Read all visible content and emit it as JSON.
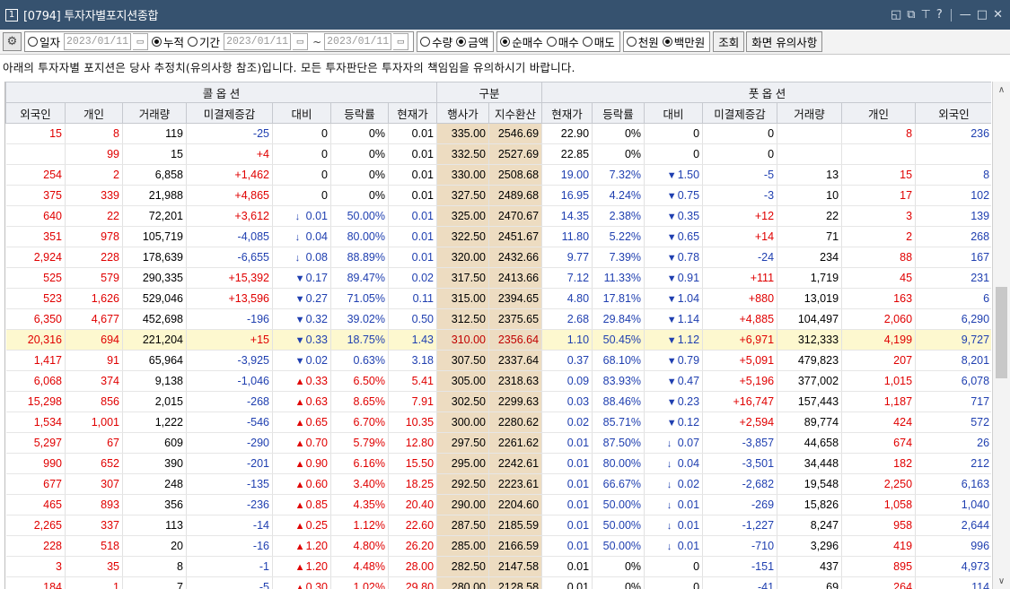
{
  "window": {
    "number": "1",
    "title": "[0794] 투자자별포지션종합",
    "controls": [
      "◱",
      "⧉",
      "⊤",
      "?",
      "—",
      "□",
      "✕"
    ]
  },
  "toolbar": {
    "gear_icon": "⚙",
    "radio_daily": "일자",
    "date_single": "2023/01/11",
    "radio_cumulative": "누적",
    "radio_period": "기간",
    "date_from": "2023/01/11",
    "tilde": "~",
    "date_to": "2023/01/11",
    "radio_quantity": "수량",
    "radio_amount": "금액",
    "radio_net_buy": "순매수",
    "radio_buy": "매수",
    "radio_sell": "매도",
    "radio_thousand": "천원",
    "radio_million": "백만원",
    "query_button": "조회",
    "notice_button": "화면 유의사항",
    "calendar_icon": "▭"
  },
  "notice": "아래의 투자자별 포지션은 당사 추정치(유의사항 참조)입니다. 모든 투자판단은 투자자의 책임임을 유의하시기 바랍니다.",
  "grid": {
    "group_call": "콜 옵 션",
    "group_mid": "구분",
    "group_put": "풋 옵 션",
    "columns": [
      "외국인",
      "개인",
      "거래량",
      "미결제증감",
      "대비",
      "등락률",
      "현재가",
      "행사가",
      "지수환산",
      "현재가",
      "등락률",
      "대비",
      "미결제증감",
      "거래량",
      "개인",
      "외국인"
    ],
    "rows": [
      [
        "15",
        "8",
        "119",
        "-25",
        "",
        "0",
        "0%",
        "0.01",
        "335.00",
        "2546.69",
        "22.90",
        "0%",
        "",
        "0",
        "0",
        "",
        "8",
        "236"
      ],
      [
        "",
        "99",
        "15",
        "+4",
        "",
        "0",
        "0%",
        "0.01",
        "332.50",
        "2527.69",
        "22.85",
        "0%",
        "",
        "0",
        "0",
        "",
        "",
        ""
      ],
      [
        "254",
        "2",
        "6,858",
        "+1,462",
        "",
        "0",
        "0%",
        "0.01",
        "330.00",
        "2508.68",
        "19.00",
        "7.32%",
        "▼",
        "1.50",
        "-5",
        "13",
        "15",
        "8"
      ],
      [
        "375",
        "339",
        "21,988",
        "+4,865",
        "",
        "0",
        "0%",
        "0.01",
        "327.50",
        "2489.68",
        "16.95",
        "4.24%",
        "▼",
        "0.75",
        "-3",
        "10",
        "17",
        "102"
      ],
      [
        "640",
        "22",
        "72,201",
        "+3,612",
        "↓",
        "0.01",
        "50.00%",
        "0.01",
        "325.00",
        "2470.67",
        "14.35",
        "2.38%",
        "▼",
        "0.35",
        "+12",
        "22",
        "3",
        "139"
      ],
      [
        "351",
        "978",
        "105,719",
        "-4,085",
        "↓",
        "0.04",
        "80.00%",
        "0.01",
        "322.50",
        "2451.67",
        "11.80",
        "5.22%",
        "▼",
        "0.65",
        "+14",
        "71",
        "2",
        "268"
      ],
      [
        "2,924",
        "228",
        "178,639",
        "-6,655",
        "↓",
        "0.08",
        "88.89%",
        "0.01",
        "320.00",
        "2432.66",
        "9.77",
        "7.39%",
        "▼",
        "0.78",
        "-24",
        "234",
        "88",
        "167"
      ],
      [
        "525",
        "579",
        "290,335",
        "+15,392",
        "▼",
        "0.17",
        "89.47%",
        "0.02",
        "317.50",
        "2413.66",
        "7.12",
        "11.33%",
        "▼",
        "0.91",
        "+111",
        "1,719",
        "45",
        "231"
      ],
      [
        "523",
        "1,626",
        "529,046",
        "+13,596",
        "▼",
        "0.27",
        "71.05%",
        "0.11",
        "315.00",
        "2394.65",
        "4.80",
        "17.81%",
        "▼",
        "1.04",
        "+880",
        "13,019",
        "163",
        "6"
      ],
      [
        "6,350",
        "4,677",
        "452,698",
        "-196",
        "▼",
        "0.32",
        "39.02%",
        "0.50",
        "312.50",
        "2375.65",
        "2.68",
        "29.84%",
        "▼",
        "1.14",
        "+4,885",
        "104,497",
        "2,060",
        "6,290"
      ],
      [
        "20,316",
        "694",
        "221,204",
        "+15",
        "▼",
        "0.33",
        "18.75%",
        "1.43",
        "310.00",
        "2356.64",
        "1.10",
        "50.45%",
        "▼",
        "1.12",
        "+6,971",
        "312,333",
        "4,199",
        "9,727"
      ],
      [
        "1,417",
        "91",
        "65,964",
        "-3,925",
        "▼",
        "0.02",
        "0.63%",
        "3.18",
        "307.50",
        "2337.64",
        "0.37",
        "68.10%",
        "▼",
        "0.79",
        "+5,091",
        "479,823",
        "207",
        "8,201"
      ],
      [
        "6,068",
        "374",
        "9,138",
        "-1,046",
        "▲",
        "0.33",
        "6.50%",
        "5.41",
        "305.00",
        "2318.63",
        "0.09",
        "83.93%",
        "▼",
        "0.47",
        "+5,196",
        "377,002",
        "1,015",
        "6,078"
      ],
      [
        "15,298",
        "856",
        "2,015",
        "-268",
        "▲",
        "0.63",
        "8.65%",
        "7.91",
        "302.50",
        "2299.63",
        "0.03",
        "88.46%",
        "▼",
        "0.23",
        "+16,747",
        "157,443",
        "1,187",
        "717"
      ],
      [
        "1,534",
        "1,001",
        "1,222",
        "-546",
        "▲",
        "0.65",
        "6.70%",
        "10.35",
        "300.00",
        "2280.62",
        "0.02",
        "85.71%",
        "▼",
        "0.12",
        "+2,594",
        "89,774",
        "424",
        "572"
      ],
      [
        "5,297",
        "67",
        "609",
        "-290",
        "▲",
        "0.70",
        "5.79%",
        "12.80",
        "297.50",
        "2261.62",
        "0.01",
        "87.50%",
        "↓",
        "0.07",
        "-3,857",
        "44,658",
        "674",
        "26"
      ],
      [
        "990",
        "652",
        "390",
        "-201",
        "▲",
        "0.90",
        "6.16%",
        "15.50",
        "295.00",
        "2242.61",
        "0.01",
        "80.00%",
        "↓",
        "0.04",
        "-3,501",
        "34,448",
        "182",
        "212"
      ],
      [
        "677",
        "307",
        "248",
        "-135",
        "▲",
        "0.60",
        "3.40%",
        "18.25",
        "292.50",
        "2223.61",
        "0.01",
        "66.67%",
        "↓",
        "0.02",
        "-2,682",
        "19,548",
        "2,250",
        "6,163"
      ],
      [
        "465",
        "893",
        "356",
        "-236",
        "▲",
        "0.85",
        "4.35%",
        "20.40",
        "290.00",
        "2204.60",
        "0.01",
        "50.00%",
        "↓",
        "0.01",
        "-269",
        "15,826",
        "1,058",
        "1,040"
      ],
      [
        "2,265",
        "337",
        "113",
        "-14",
        "▲",
        "0.25",
        "1.12%",
        "22.60",
        "287.50",
        "2185.59",
        "0.01",
        "50.00%",
        "↓",
        "0.01",
        "-1,227",
        "8,247",
        "958",
        "2,644"
      ],
      [
        "228",
        "518",
        "20",
        "-16",
        "▲",
        "1.20",
        "4.80%",
        "26.20",
        "285.00",
        "2166.59",
        "0.01",
        "50.00%",
        "↓",
        "0.01",
        "-710",
        "3,296",
        "419",
        "996"
      ],
      [
        "3",
        "35",
        "8",
        "-1",
        "▲",
        "1.20",
        "4.48%",
        "28.00",
        "282.50",
        "2147.58",
        "0.01",
        "0%",
        "",
        "0",
        "-151",
        "437",
        "895",
        "4,973"
      ],
      [
        "184",
        "1",
        "7",
        "-5",
        "▲",
        "0.30",
        "1.02%",
        "29.80",
        "280.00",
        "2128.58",
        "0.01",
        "0%",
        "",
        "0",
        "-41",
        "69",
        "264",
        "114"
      ]
    ]
  },
  "scrollbar": {
    "up_icon": "∧",
    "down_icon": "∨"
  },
  "colors": {
    "title_bg": "#36526f",
    "strike_bg": "#eddcc1",
    "atm_row": "#fdf8cf",
    "up_red": "#e00000",
    "down_blue": "#1f3fb0"
  }
}
